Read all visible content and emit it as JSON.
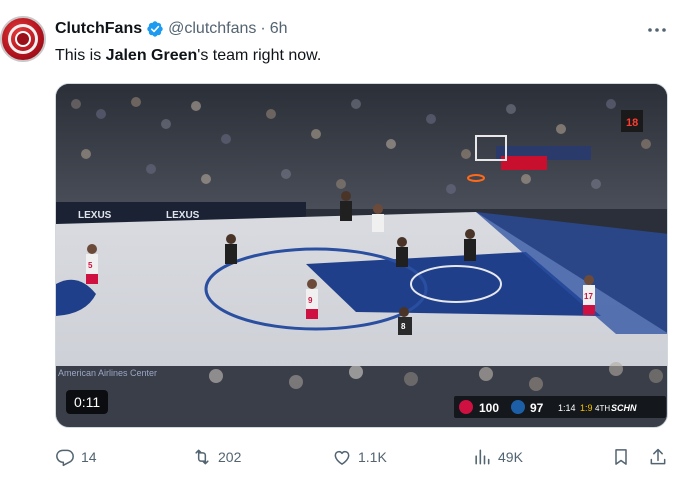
{
  "tweet": {
    "display_name": "ClutchFans",
    "handle": "@clutchfans",
    "separator": "·",
    "time": "6h",
    "text_before": "This is ",
    "text_bold": "Jalen Green",
    "text_after": "'s team right now."
  },
  "media": {
    "duration": "0:11",
    "scoreboard": {
      "home_score": "100",
      "away_score": "97",
      "period": "1:14",
      "shot_clock": "1:9",
      "quarter": "4TH",
      "network": "SCHN"
    },
    "jersey_numbers": [
      "5",
      "9",
      "17",
      "8"
    ],
    "arena_text": [
      "LEXUS",
      "LEXUS",
      "American Airlines Center"
    ],
    "shot_display": "18"
  },
  "actions": {
    "replies": "14",
    "reposts": "202",
    "likes": "1.1K",
    "views": "49K"
  },
  "colors": {
    "text_primary": "#0f1419",
    "text_secondary": "#536471",
    "verified": "#1d9bf0",
    "court_blue": "#1f3f8a",
    "rockets_red": "#ce1141"
  },
  "icons": [
    "verified-badge-icon",
    "more-icon",
    "reply-icon",
    "repost-icon",
    "like-icon",
    "views-icon",
    "bookmark-icon",
    "share-icon"
  ]
}
